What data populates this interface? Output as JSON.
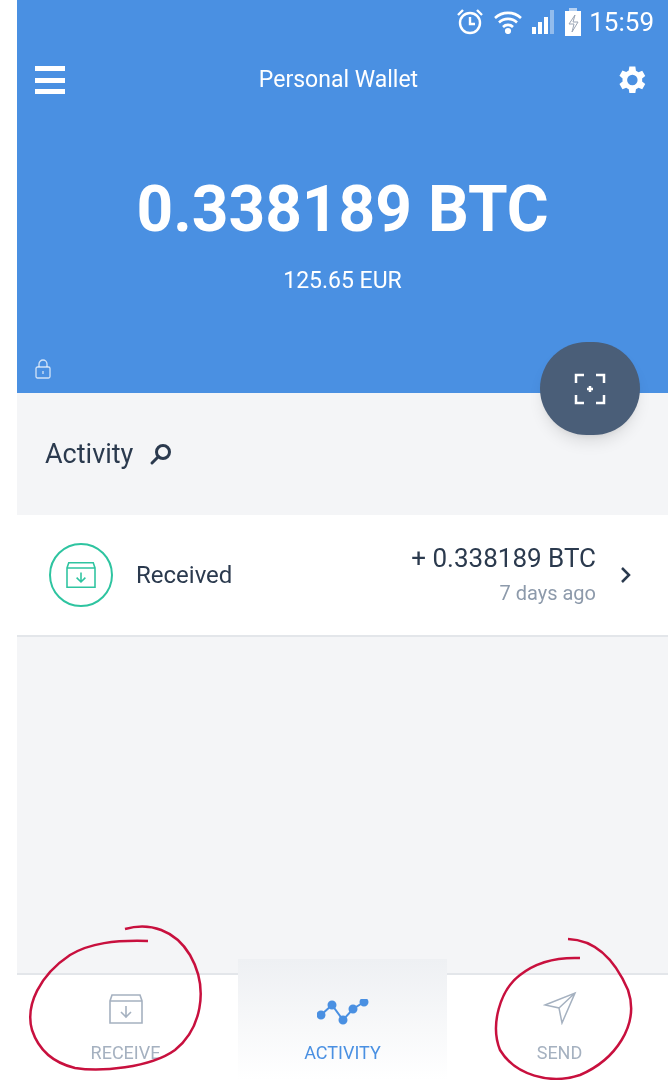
{
  "status_bar": {
    "time": "15:59"
  },
  "header": {
    "title": "Personal Wallet",
    "balance": "0.338189 BTC",
    "fiat": "125.65 EUR"
  },
  "activity": {
    "title": "Activity",
    "items": [
      {
        "kind": "received",
        "label": "Received",
        "amount": "+ 0.338189 BTC",
        "time": "7 days ago"
      }
    ]
  },
  "tabs": [
    {
      "kind": "receive",
      "label": "RECEIVE",
      "selected": false
    },
    {
      "kind": "activity",
      "label": "ACTIVITY",
      "selected": true
    },
    {
      "kind": "send",
      "label": "SEND",
      "selected": false
    }
  ]
}
